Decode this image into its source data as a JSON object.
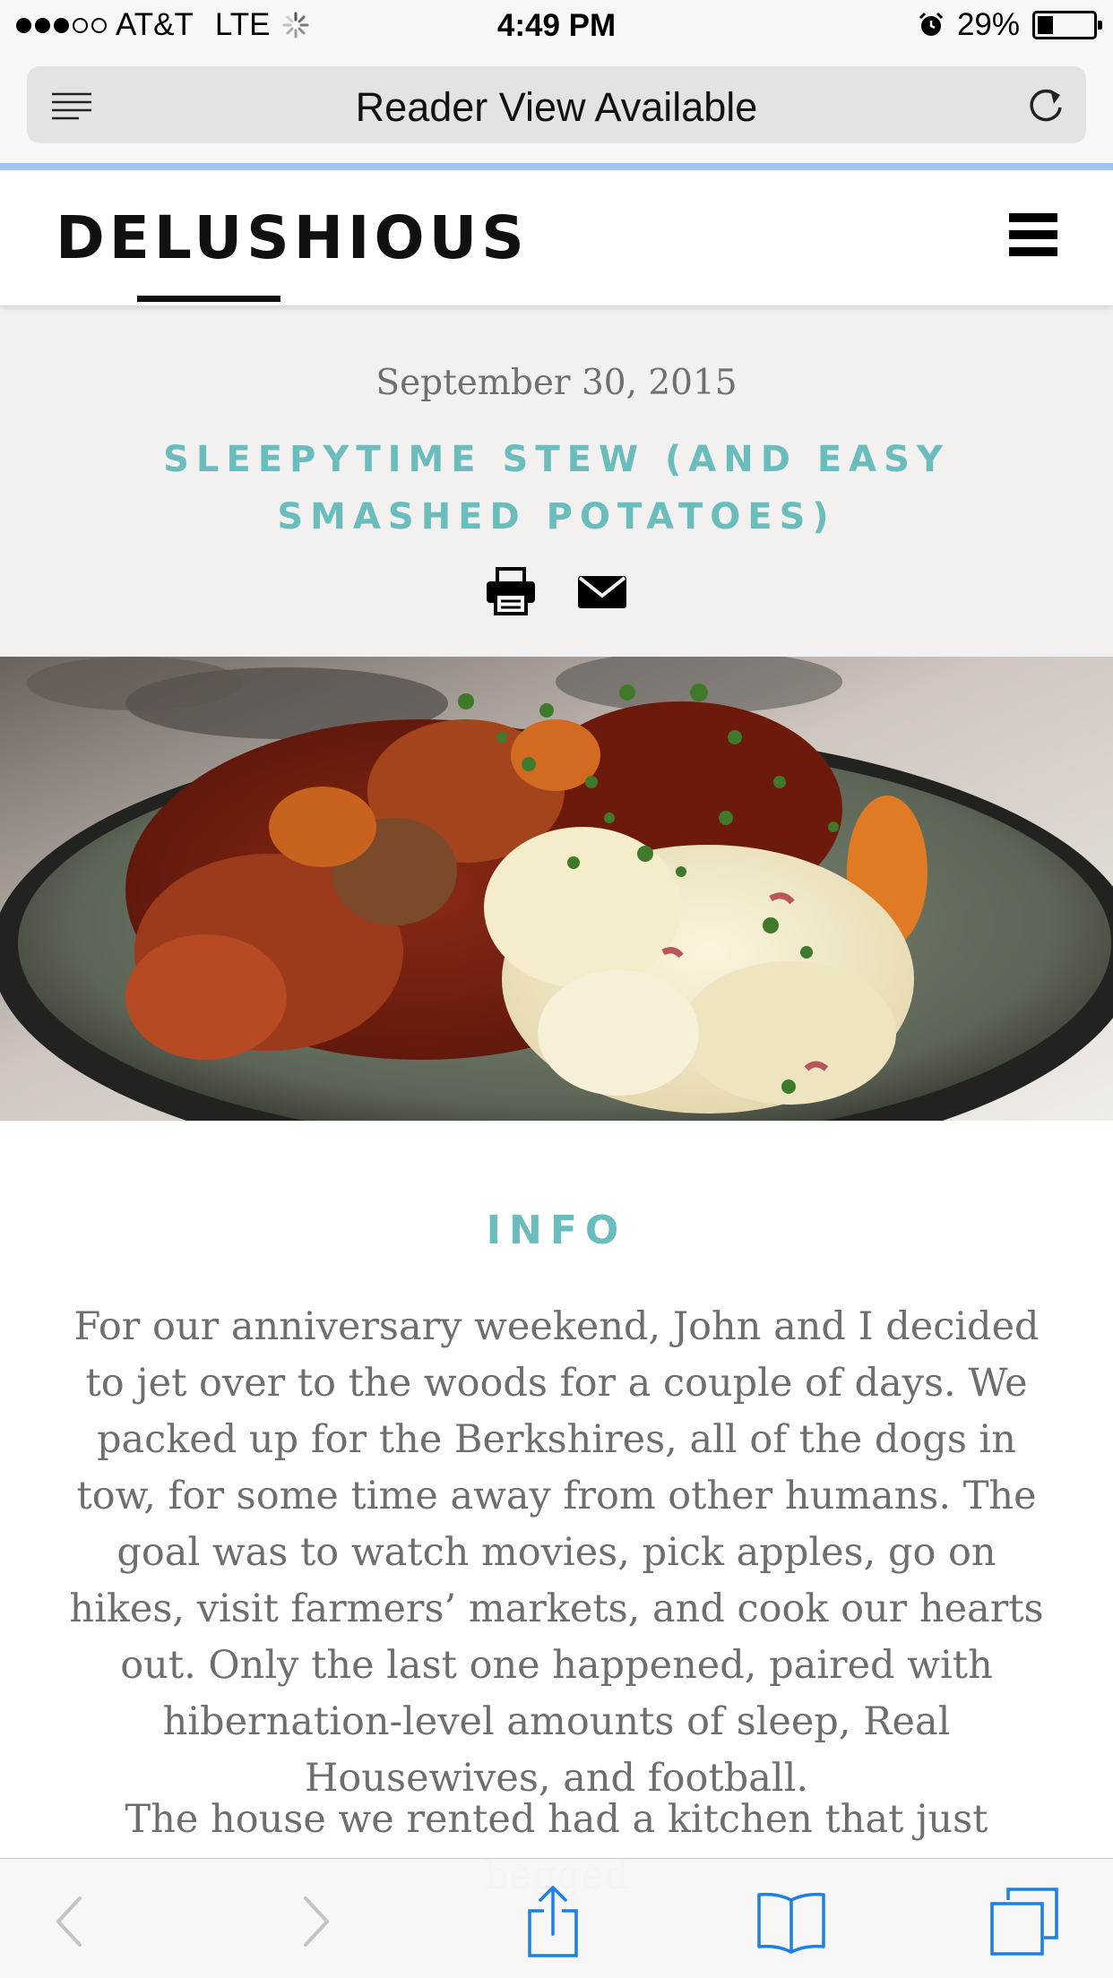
{
  "status_bar": {
    "carrier": "AT&T",
    "network": "LTE",
    "signal_bars": 3,
    "signal_total": 5,
    "time": "4:49 PM",
    "battery_text": "29%",
    "battery_level": 0.29
  },
  "browser": {
    "address_text": "Reader View Available",
    "load_progress": 1.0,
    "progress_color": "#9ec4f1"
  },
  "site": {
    "logo_text": "DELUSHIOUS"
  },
  "post": {
    "date": "September 30, 2015",
    "title": "SLEEPYTIME STEW (AND EASY SMASHED POTATOES)",
    "accent_color": "#6bbcbd",
    "share_icons": [
      "print-icon",
      "mail-icon"
    ]
  },
  "article": {
    "section_heading": "INFO",
    "paragraphs": [
      "For our anniversary weekend, John and I decided to jet over to the woods for a couple of days. We packed up for the Berkshires, all of the dogs in tow, for some time away from other humans. The goal was to watch movies, pick apples, go on hikes, visit farmers’ markets, and cook our hearts out. Only the last one happened, paired with hibernation-level amounts of sleep, Real Housewives, and football.",
      "The house we rented had a kitchen that just begged"
    ]
  },
  "toolbar": {
    "icons": [
      "back-icon",
      "forward-icon",
      "share-icon",
      "bookmarks-icon",
      "tabs-icon"
    ],
    "tint_color": "#1a7fe8",
    "disabled_color": "#c3c3c8"
  }
}
